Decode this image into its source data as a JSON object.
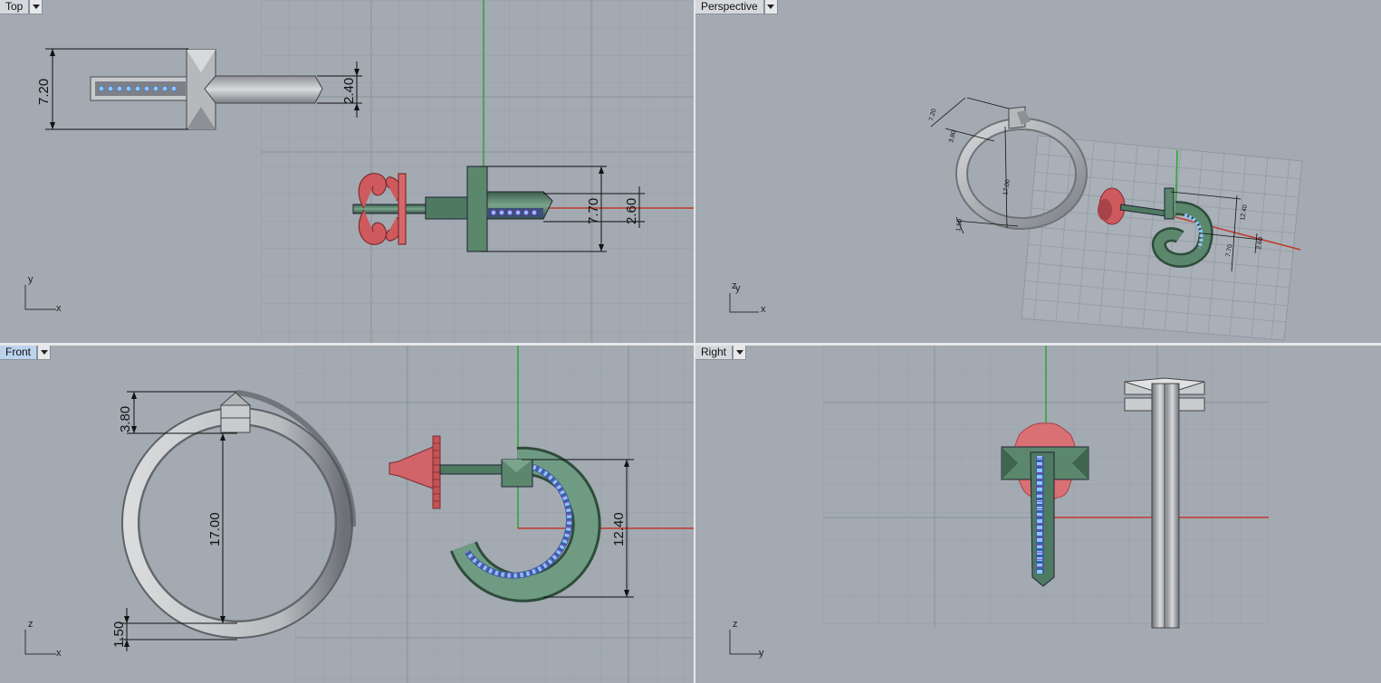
{
  "viewports": {
    "top": {
      "label": "Top",
      "axes": {
        "vertical": "y",
        "horizontal": "x"
      },
      "dims": {
        "d1": "7.20",
        "d2": "2.40",
        "d3": "7.70",
        "d4": "2.60"
      }
    },
    "perspective": {
      "label": "Perspective",
      "axes": {
        "vertical": "z",
        "vertical2": "y",
        "horizontal": "x"
      },
      "dims": {
        "d1": "7.20",
        "d2": "3.80",
        "d3": "17.00",
        "d4": "1.50",
        "d5": "12.40",
        "d6": "7.70",
        "d7": "2.60"
      }
    },
    "front": {
      "label": "Front",
      "active": true,
      "axes": {
        "vertical": "z",
        "horizontal": "x"
      },
      "dims": {
        "d1": "3.80",
        "d2": "17.00",
        "d3": "1.50",
        "d4": "12.40"
      }
    },
    "right": {
      "label": "Right",
      "axes": {
        "vertical": "z",
        "horizontal": "y"
      }
    }
  },
  "colors": {
    "viewport_bg": "#a3aab2",
    "grid_minor": "#98a0a9",
    "grid_major": "#8a929b",
    "axis_x": "#c0392b",
    "axis_y": "#2aa82a",
    "ring_gray": "#b4b7ba",
    "earring_green": "#4f7a62",
    "backing_red": "#cf5a5e",
    "gem_blue": "#8ec5ff",
    "prong_purple": "#8a3fbf"
  },
  "icons": [
    "dropdown-arrow-icon",
    "axis-triad-icon"
  ]
}
